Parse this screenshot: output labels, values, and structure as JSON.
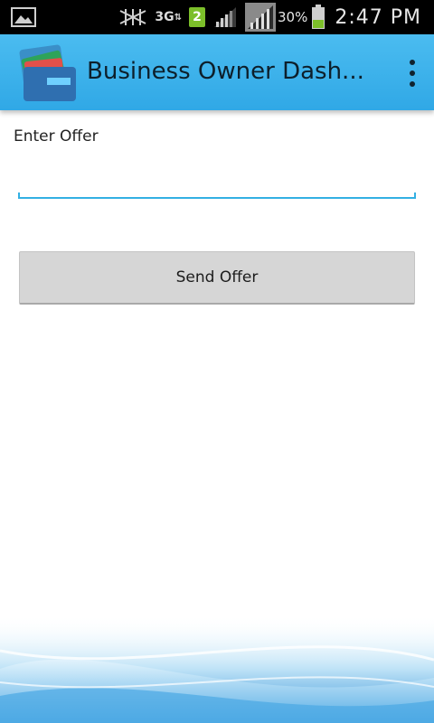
{
  "status_bar": {
    "network_type": "3G",
    "sim_slot": "2",
    "battery_percent": "30%",
    "time": "2:47 PM",
    "icons": [
      "gallery-icon",
      "no-signal-icon",
      "signal-bars-icon",
      "signal-bars-icon",
      "battery-icon"
    ]
  },
  "action_bar": {
    "title": "Business Owner Dash...",
    "logo_icon": "wallet-cards-icon",
    "menu_icon": "overflow-menu-icon",
    "color": "#33aae8"
  },
  "form": {
    "offer_label": "Enter Offer",
    "offer_value": "",
    "send_button_label": "Send Offer",
    "accent_color": "#33b0e3"
  }
}
